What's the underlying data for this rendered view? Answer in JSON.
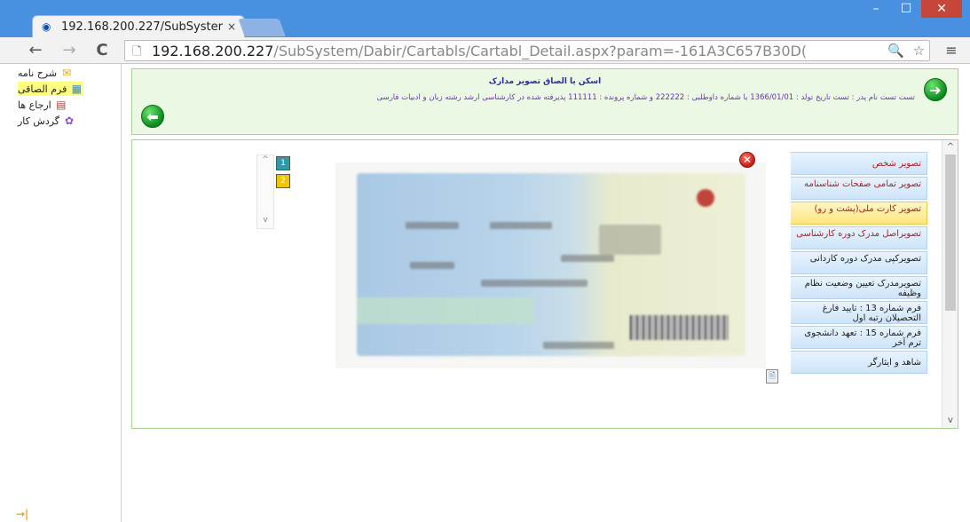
{
  "browser": {
    "tab_title": "192.168.200.227/SubSyster",
    "tab_close": "×",
    "url_host": "192.168.200.227",
    "url_path": "/SubSystem/Dabir/Cartabls/Cartabl_Detail.aspx?param=-161A3C657B30D(",
    "window_controls": [
      "–",
      "☐",
      "✕"
    ],
    "nav": {
      "back": "←",
      "forward": "→",
      "reload": "C"
    },
    "omni_icons": [
      "🔍",
      "☆"
    ],
    "menu": "≡"
  },
  "sidebar": {
    "items": [
      {
        "label": "شرح نامه",
        "icon": "envelope-icon",
        "glyph": "✉",
        "active": false
      },
      {
        "label": "فرم الصاقی",
        "icon": "form-icon",
        "glyph": "▦",
        "active": true
      },
      {
        "label": "ارجاع ها",
        "icon": "forward-icon",
        "glyph": "▤",
        "active": false
      },
      {
        "label": "گردش کار",
        "icon": "workflow-icon",
        "glyph": "✿",
        "active": false
      }
    ],
    "bottom_arrow": "→|"
  },
  "header": {
    "title": "اسکن یا الصاق تصویر مدارک",
    "info": "تست تست نام پدر : تست تاریخ تولد : 1366/01/01 با شماره داوطلبی : 222222 و شماره پرونده : 111111 پذیرفته شده در کارشناسی ارشد رشته زبان و ادبیات فارسی",
    "forward_arrow": "➜",
    "back_arrow": "⬅"
  },
  "documents": {
    "tabs": [
      {
        "label": "تصویر شخص",
        "active": false,
        "dark": false
      },
      {
        "label": "تصویر تمامی صفحات شناسنامه",
        "active": false,
        "dark": false
      },
      {
        "label": "تصویر کارت ملی(پشت و رو)",
        "active": true,
        "dark": false
      },
      {
        "label": "تصویراصل مدرک دوره کارشناسی",
        "active": false,
        "dark": false
      },
      {
        "label": "تصویرکپی مدرک دوره کاردانی",
        "active": false,
        "dark": true
      },
      {
        "label": "تصویرمدرک تعیین وضعیت نظام وظیفه",
        "active": false,
        "dark": true
      },
      {
        "label": "فرم شماره 13 : تایید فارغ التحصیلان رتبه اول",
        "active": false,
        "dark": true
      },
      {
        "label": "فرم شماره 15 : تعهد دانشجوی ترم آخر",
        "active": false,
        "dark": true
      },
      {
        "label": "شاهد و ایثارگر",
        "active": false,
        "dark": true
      }
    ],
    "pages": [
      "1",
      "2"
    ],
    "pager_up": "^",
    "pager_down": "v",
    "close_glyph": "✕",
    "attach_glyph": "🖹"
  },
  "scroll": {
    "up": "^",
    "down": "v"
  },
  "colors": {
    "chrome_blue": "#4a90e0",
    "panel_green": "#eaf8e4",
    "panel_border": "#a6d494",
    "title_blue": "#2b2ba8",
    "info_purple": "#6a35b0",
    "active_tab": "#ffe680"
  }
}
